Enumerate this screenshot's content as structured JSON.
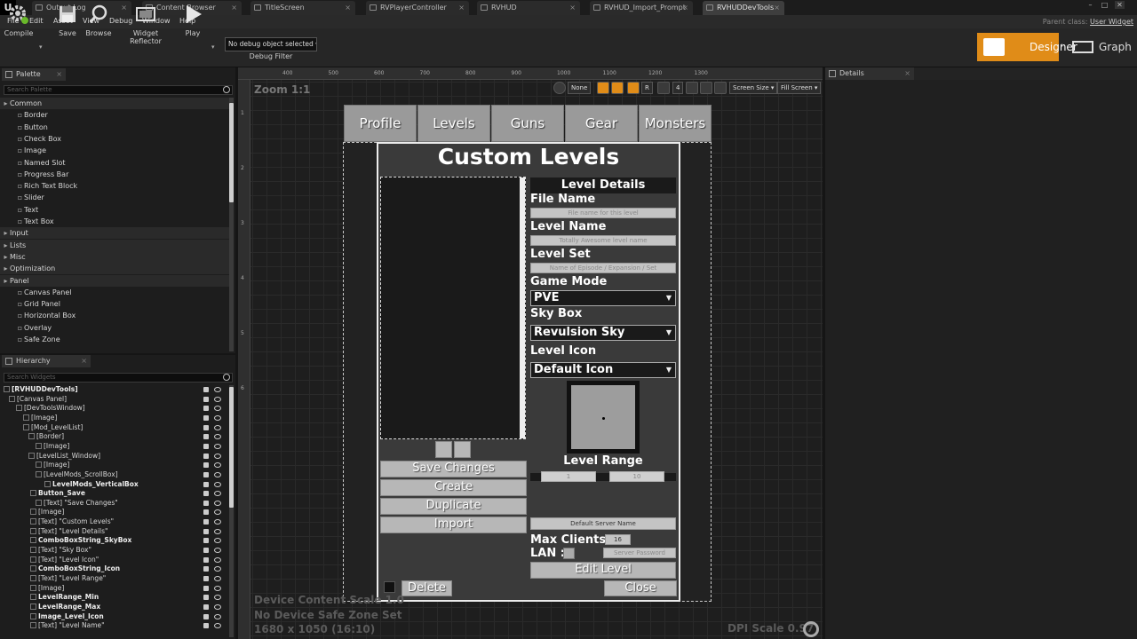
{
  "editor": {
    "tabs": [
      {
        "label": "Output Log"
      },
      {
        "label": "Content Browser"
      },
      {
        "label": "TitleScreen"
      },
      {
        "label": "RVPlayerController"
      },
      {
        "label": "RVHUD"
      },
      {
        "label": "RVHUD_Import_Prompt"
      },
      {
        "label": "RVHUDDevTools"
      }
    ],
    "menus": [
      "File",
      "Edit",
      "Asset",
      "View",
      "Debug",
      "Window",
      "Help"
    ],
    "parent_class_label": "Parent class:",
    "parent_class_value": "User Widget",
    "toolbar": {
      "compile": "Compile",
      "save": "Save",
      "browse": "Browse",
      "widget_reflector": "Widget Reflector",
      "play": "Play",
      "debug_select": "No debug object selected",
      "debug_filter": "Debug Filter"
    },
    "mode": {
      "designer": "Designer",
      "graph": "Graph"
    },
    "accent_color": "#e08c18"
  },
  "palette": {
    "title": "Palette",
    "search_placeholder": "Search Palette",
    "items": [
      {
        "label": "Common",
        "category": true
      },
      {
        "label": "Border"
      },
      {
        "label": "Button"
      },
      {
        "label": "Check Box"
      },
      {
        "label": "Image"
      },
      {
        "label": "Named Slot"
      },
      {
        "label": "Progress Bar"
      },
      {
        "label": "Rich Text Block"
      },
      {
        "label": "Slider"
      },
      {
        "label": "Text"
      },
      {
        "label": "Text Box"
      },
      {
        "label": "Input",
        "category": true
      },
      {
        "label": "Lists",
        "category": true
      },
      {
        "label": "Misc",
        "category": true
      },
      {
        "label": "Optimization",
        "category": true
      },
      {
        "label": "Panel",
        "category": true
      },
      {
        "label": "Canvas Panel"
      },
      {
        "label": "Grid Panel"
      },
      {
        "label": "Horizontal Box"
      },
      {
        "label": "Overlay"
      },
      {
        "label": "Safe Zone"
      }
    ]
  },
  "hierarchy": {
    "title": "Hierarchy",
    "search_placeholder": "Search Widgets",
    "items": [
      {
        "label": "[RVHUDDevTools]",
        "bold": true
      },
      {
        "label": "[Canvas Panel]"
      },
      {
        "label": "[DevToolsWindow]"
      },
      {
        "label": "[Image]"
      },
      {
        "label": "[Mod_LevelList]"
      },
      {
        "label": "[Border]"
      },
      {
        "label": "[Image]"
      },
      {
        "label": "[LevelList_Window]"
      },
      {
        "label": "[Image]"
      },
      {
        "label": "[LevelMods_ScrollBox]"
      },
      {
        "label": "LevelMods_VerticalBox",
        "bold": true
      },
      {
        "label": "Button_Save",
        "bold": true
      },
      {
        "label": "[Text] \"Save Changes\""
      },
      {
        "label": "[Image]"
      },
      {
        "label": "[Text] \"Custom Levels\""
      },
      {
        "label": "[Text] \"Level Details\""
      },
      {
        "label": "ComboBoxString_SkyBox",
        "bold": true
      },
      {
        "label": "[Text] \"Sky Box\""
      },
      {
        "label": "[Text] \"Level Icon\""
      },
      {
        "label": "ComboBoxString_Icon",
        "bold": true
      },
      {
        "label": "[Text] \"Level Range\""
      },
      {
        "label": "[Image]"
      },
      {
        "label": "LevelRange_Min",
        "bold": true
      },
      {
        "label": "LevelRange_Max",
        "bold": true
      },
      {
        "label": "Image_Level_Icon",
        "bold": true
      },
      {
        "label": "[Text] \"Level Name\""
      }
    ]
  },
  "viewport": {
    "zoom": "Zoom 1:1",
    "ruler_top": [
      "400",
      "500",
      "600",
      "700",
      "800",
      "900",
      "1000",
      "1100",
      "1200",
      "1300"
    ],
    "ruler_left": [
      "1",
      "2",
      "3",
      "4",
      "5",
      "6"
    ],
    "tool_none": "None",
    "tool_r": "R",
    "tool_4": "4",
    "screen_size": "Screen Size",
    "fill_screen": "Fill Screen",
    "device_content_scale": "Device Content Scale 1.0",
    "safe_zone": "No Device Safe Zone Set",
    "resolution": "1680 x 1050 (16:10)",
    "dpi_scale": "DPI Scale 0.97"
  },
  "details": {
    "title": "Details"
  },
  "widget": {
    "nav_tabs": [
      "Profile",
      "Levels",
      "Guns",
      "Gear",
      "Monsters"
    ],
    "title": "Custom Levels",
    "level_details": "Level Details",
    "file_name_label": "File Name",
    "file_name_placeholder": "File name for this level",
    "level_name_label": "Level Name",
    "level_name_placeholder": "Totally Awesome level name",
    "level_set_label": "Level Set",
    "level_set_placeholder": "Name of Episode / Expansion / Set",
    "game_mode_label": "Game Mode",
    "game_mode_value": "PVE",
    "sky_box_label": "Sky Box",
    "sky_box_value": "Revulsion Sky",
    "level_icon_label": "Level Icon",
    "level_icon_value": "Default Icon",
    "level_range_label": "Level Range",
    "level_range_min": "1",
    "level_range_max": "10",
    "buttons": {
      "save": "Save Changes",
      "create": "Create",
      "duplicate": "Duplicate",
      "import": "Import",
      "edit": "Edit Level",
      "delete": "Delete",
      "close": "Close"
    },
    "server_name": "Default Server Name",
    "max_clients_label": "Max Clients :",
    "max_clients_value": "16",
    "lan_label": "LAN :",
    "server_password_placeholder": "Server Password"
  }
}
